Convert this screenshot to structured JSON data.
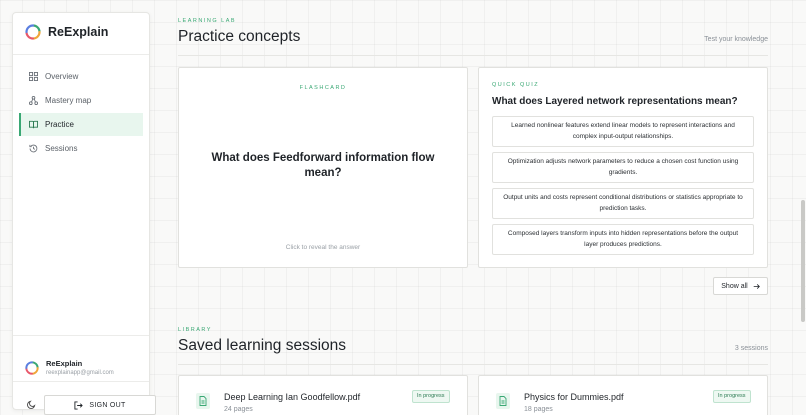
{
  "app": {
    "name": "ReExplain"
  },
  "nav": {
    "items": [
      {
        "label": "Overview",
        "icon": "grid-icon",
        "active": false
      },
      {
        "label": "Mastery map",
        "icon": "network-icon",
        "active": false
      },
      {
        "label": "Practice",
        "icon": "book-icon",
        "active": true
      },
      {
        "label": "Sessions",
        "icon": "history-icon",
        "active": false
      }
    ]
  },
  "user": {
    "name": "ReExplain",
    "email": "reexplainapp@gmail.com"
  },
  "sidebar_footer": {
    "signout_label": "SIGN OUT"
  },
  "lab": {
    "eyebrow": "LEARNING LAB",
    "title": "Practice concepts",
    "aside": "Test your knowledge"
  },
  "flashcard": {
    "label": "FLASHCARD",
    "question": "What does Feedforward information flow mean?",
    "hint": "Click to reveal the answer"
  },
  "quiz": {
    "label": "QUICK QUIZ",
    "question": "What does Layered network representations mean?",
    "options": [
      "Learned nonlinear features extend linear models to represent interactions and complex input-output relationships.",
      "Optimization adjusts network parameters to reduce a chosen cost function using gradients.",
      "Output units and costs represent conditional distributions or statistics appropriate to prediction tasks.",
      "Composed layers transform inputs into hidden representations before the output layer produces predictions."
    ]
  },
  "show_all": {
    "label": "Show all"
  },
  "library": {
    "eyebrow": "LIBRARY",
    "title": "Saved learning sessions",
    "count": "3 sessions",
    "sessions": [
      {
        "title": "Deep Learning Ian Goodfellow.pdf",
        "pages": "24 pages",
        "status": "In progress"
      },
      {
        "title": "Physics for Dummies.pdf",
        "pages": "18 pages",
        "status": "In progress"
      }
    ]
  },
  "colors": {
    "accent": "#3aa874",
    "accent_bg": "#e8f6ee",
    "text": "#1f2328"
  }
}
